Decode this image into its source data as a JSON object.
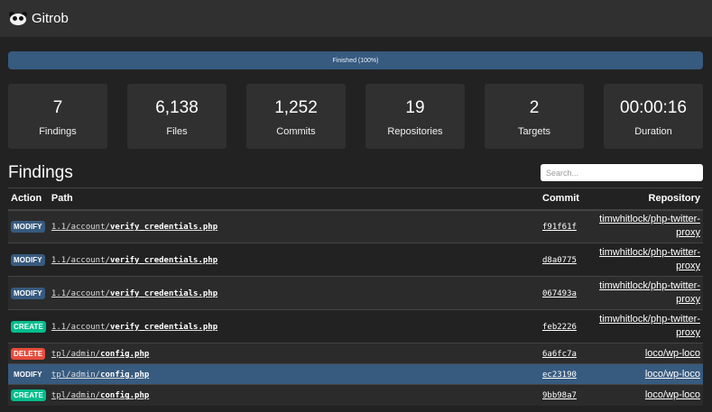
{
  "header": {
    "brand": "Gitrob",
    "logo_icon": "panda-logo-icon"
  },
  "progress": {
    "text": "Finished (100%)",
    "percent": 100
  },
  "stats": [
    {
      "value": "7",
      "label": "Findings"
    },
    {
      "value": "6,138",
      "label": "Files"
    },
    {
      "value": "1,252",
      "label": "Commits"
    },
    {
      "value": "19",
      "label": "Repositories"
    },
    {
      "value": "2",
      "label": "Targets"
    },
    {
      "value": "00:00:16",
      "label": "Duration"
    }
  ],
  "findings": {
    "title": "Findings",
    "search_placeholder": "Search...",
    "columns": {
      "action": "Action",
      "path": "Path",
      "commit": "Commit",
      "repository": "Repository"
    },
    "rows": [
      {
        "action": "MODIFY",
        "path_prefix": "1.1/account/",
        "path_file": "verify_credentials.php",
        "commit": "f91f61f",
        "repository": "timwhitlock/php-twitter-proxy"
      },
      {
        "action": "MODIFY",
        "path_prefix": "1.1/account/",
        "path_file": "verify_credentials.php",
        "commit": "d8a0775",
        "repository": "timwhitlock/php-twitter-proxy"
      },
      {
        "action": "MODIFY",
        "path_prefix": "1.1/account/",
        "path_file": "verify_credentials.php",
        "commit": "067493a",
        "repository": "timwhitlock/php-twitter-proxy"
      },
      {
        "action": "CREATE",
        "path_prefix": "1.1/account/",
        "path_file": "verify_credentials.php",
        "commit": "feb2226",
        "repository": "timwhitlock/php-twitter-proxy"
      },
      {
        "action": "DELETE",
        "path_prefix": "tpl/admin/",
        "path_file": "config.php",
        "commit": "6a6fc7a",
        "repository": "loco/wp-loco"
      },
      {
        "action": "MODIFY",
        "path_prefix": "tpl/admin/",
        "path_file": "config.php",
        "commit": "ec23190",
        "repository": "loco/wp-loco"
      },
      {
        "action": "CREATE",
        "path_prefix": "tpl/admin/",
        "path_file": "config.php",
        "commit": "9bb98a7",
        "repository": "loco/wp-loco"
      }
    ]
  },
  "colors": {
    "background": "#222222",
    "panel": "#303030",
    "primary": "#375a7f",
    "success": "#00bc8c",
    "danger": "#e74c3c"
  }
}
